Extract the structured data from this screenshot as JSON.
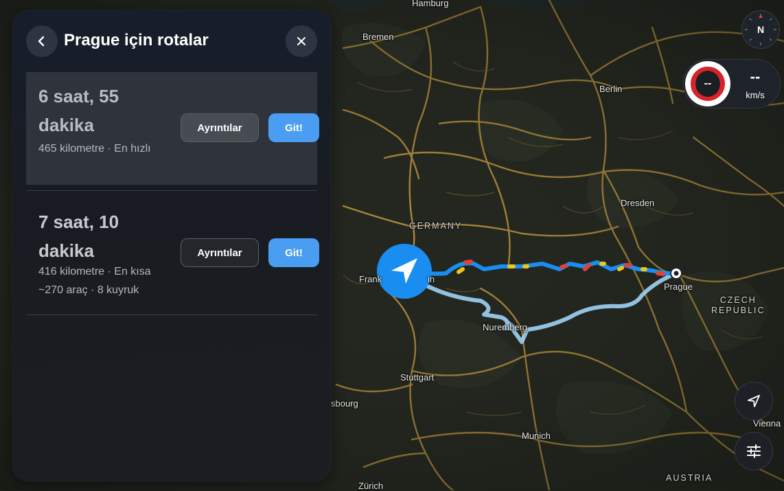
{
  "panel": {
    "title": "Prague için rotalar",
    "back_icon": "chevron-left-icon",
    "close_icon": "close-icon"
  },
  "routes": [
    {
      "time": "6 saat, 55 dakika",
      "info": "465 kilometre · En hızlı",
      "details_label": "Ayrıntılar",
      "go_label": "Git!",
      "selected": true
    },
    {
      "time": "7 saat, 10 dakika",
      "info": "416 kilometre · En kısa",
      "traffic": "~270 araç · 8 kuyruk",
      "details_label": "Ayrıntılar",
      "go_label": "Git!",
      "selected": false
    }
  ],
  "map": {
    "labels": {
      "hamburg": "Hamburg",
      "bremen": "Bremen",
      "berlin": "Berlin",
      "germany": "GERMANY",
      "dresden": "Dresden",
      "frankfurt_prefix": "Frank",
      "frankfurt_suffix": "in",
      "prague": "Prague",
      "czech_line1": "CZECH",
      "czech_line2": "REPUBLIC",
      "nuremberg": "Nuremberg",
      "stuttgart": "Stuttgart",
      "strasbourg": "sbourg",
      "munich": "Munich",
      "vienna": "Vienna",
      "austria": "AUSTRIA",
      "zurich": "Zürich"
    },
    "colors": {
      "background": "#1c2018",
      "roads": "#b8913c",
      "route_primary": "#1a8ef0",
      "route_alternative": "#9fd3f5",
      "traffic_heavy": "#e2403a",
      "traffic_moderate": "#f0c419",
      "position_marker": "#1a8ef0"
    }
  },
  "compass": {
    "label": "N",
    "icon": "compass-icon"
  },
  "speed": {
    "limit": "--",
    "value": "--",
    "unit": "km/s"
  },
  "controls": {
    "recenter_icon": "navigation-arrow-icon",
    "settings_icon": "sliders-icon"
  }
}
